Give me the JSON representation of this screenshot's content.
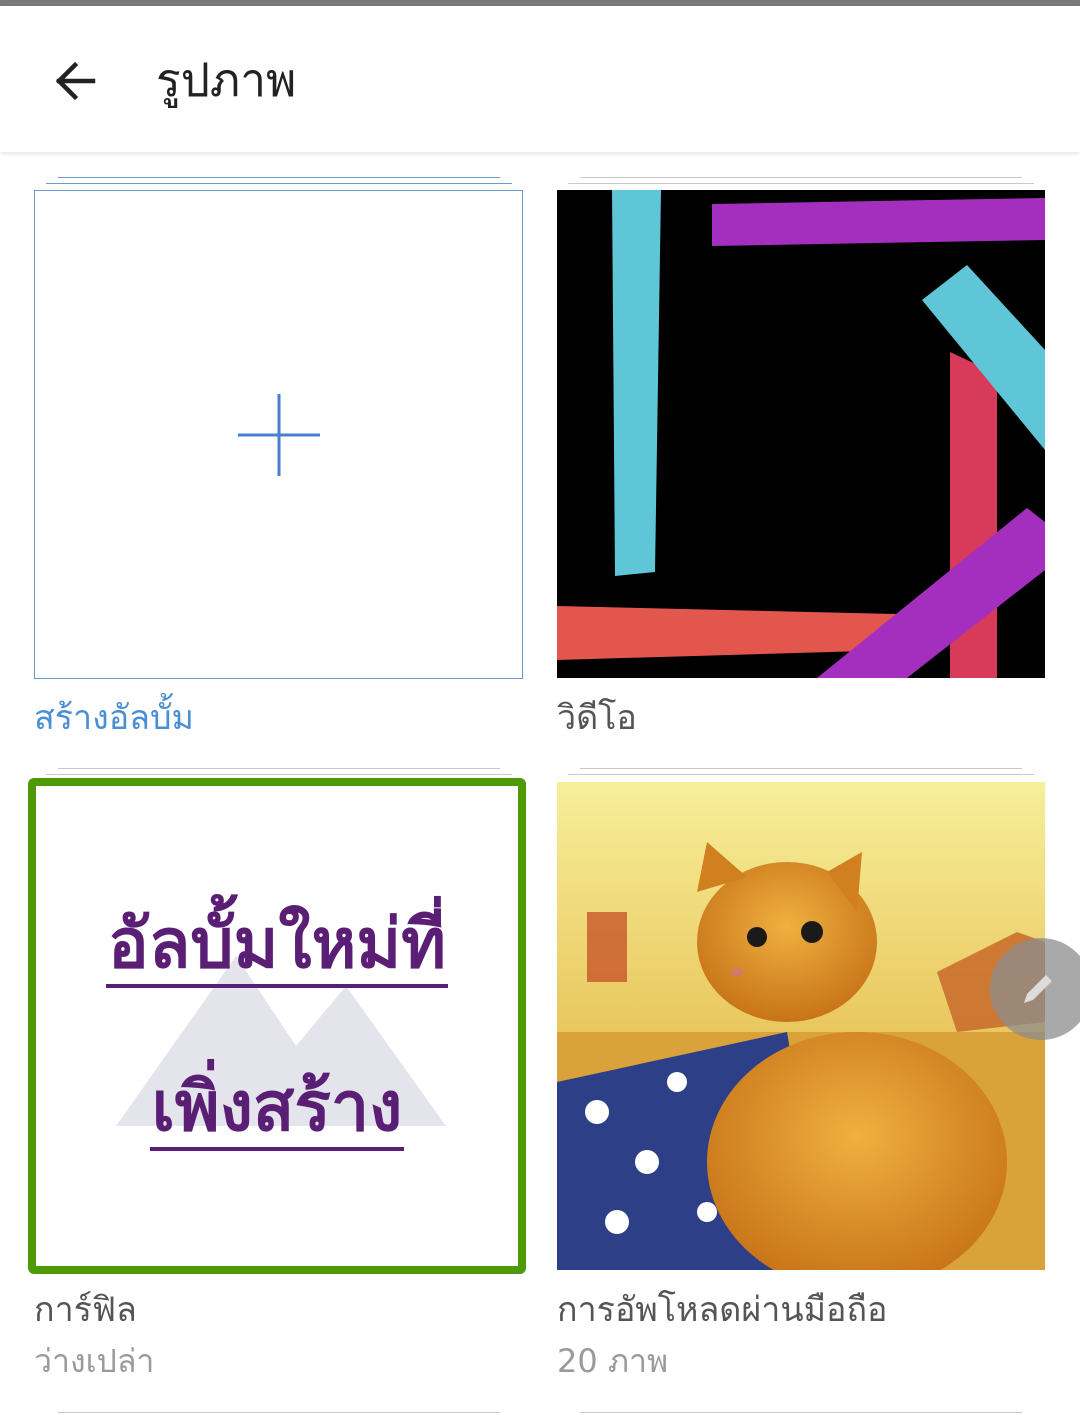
{
  "header": {
    "title": "รูปภาพ",
    "back_icon": "arrow-left-icon"
  },
  "albums": [
    {
      "caption": "สร้างอัลบั้ม",
      "icon": "plus-icon",
      "accent": "#4a8fd6"
    },
    {
      "caption": "วิดีโอ"
    },
    {
      "caption": "การ์ฟิล",
      "subcaption": "ว่างเปล่า",
      "overlay_line1": "อัลบั้มใหม่ที่",
      "overlay_line2": "เพิ่งสร้าง",
      "highlight": "#4e9a06"
    },
    {
      "caption": "การอัพโหลดผ่านมือถือ",
      "subcaption": "20 ภาพ"
    }
  ],
  "fab": {
    "icon": "pencil-icon"
  }
}
